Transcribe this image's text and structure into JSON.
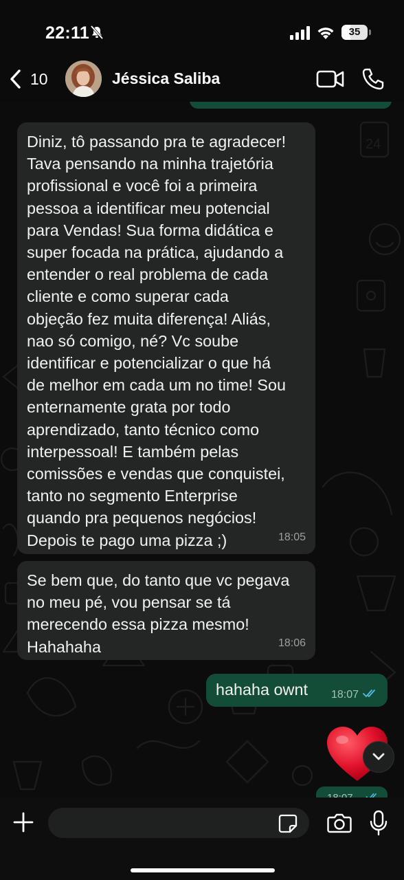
{
  "status_bar": {
    "time": "22:11",
    "battery_level": "35",
    "battery_fraction": 0.35,
    "icons": [
      "bell-slash-icon",
      "cellular-signal-icon",
      "wifi-icon",
      "battery-icon"
    ]
  },
  "header": {
    "back_count": "10",
    "contact_name": "Jéssica Saliba",
    "icons": [
      "back-chevron-icon",
      "video-call-icon",
      "phone-icon"
    ]
  },
  "messages": [
    {
      "direction": "incoming",
      "text": "Diniz, tô passando pra te agradecer!\nTava pensando na minha trajetória\nprofissional e você foi a primeira\npessoa a identificar meu potencial\npara Vendas! Sua forma didática e\nsuper focada na prática, ajudando a\nentender o real problema de cada\ncliente e como superar cada\nobjeção fez muita diferença! Aliás,\nnao só comigo, né? Vc soube\nidentificar e potencializar o que há\nde melhor em cada um no time! Sou\nenternamente grata por todo\naprendizado, tanto técnico como\ninterpessoal! E também pelas\ncomissões e vendas que conquistei,\ntanto no segmento Enterprise\nquando pra pequenos negócios!\nDepois te pago uma pizza ;)",
      "time": "18:05"
    },
    {
      "direction": "incoming",
      "text": "Se bem que, do tanto que vc pegava\nno meu pé, vou pensar se tá\nmerecendo essa pizza mesmo!\nHahahaha",
      "time": "18:06"
    },
    {
      "direction": "outgoing",
      "text": "hahaha ownt",
      "time": "18:07",
      "status": "read"
    },
    {
      "direction": "outgoing",
      "type": "reaction",
      "emoji": "heart"
    },
    {
      "direction": "outgoing",
      "time": "18:07",
      "status": "read",
      "partially_visible": true
    }
  ],
  "composer": {
    "placeholder": "",
    "icons": [
      "plus-icon",
      "sticker-icon",
      "camera-icon",
      "microphone-icon"
    ]
  },
  "colors": {
    "incoming_bubble": "#242626",
    "outgoing_bubble": "#144d37",
    "read_ticks": "#53bdeb",
    "heart": "#e0102a"
  }
}
